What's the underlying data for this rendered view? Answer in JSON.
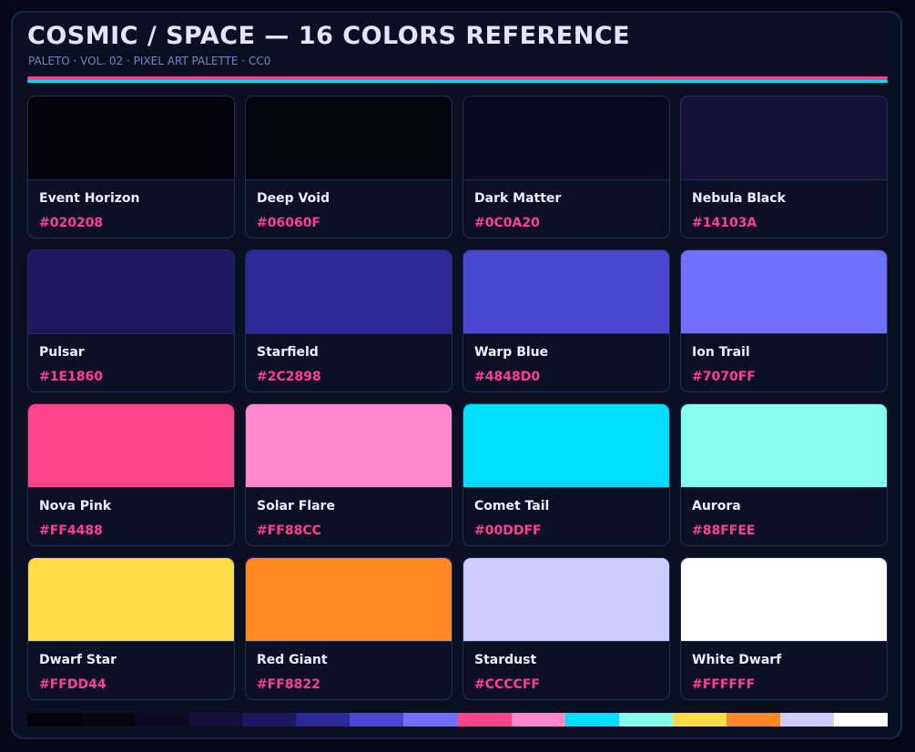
{
  "header": {
    "title": "COSMIC / SPACE — 16 COLORS REFERENCE",
    "subtitle": "PALETO · VOL. 02 · PIXEL ART PALETTE · CC0"
  },
  "accent_colors": {
    "rule_top": "#ff3e8a",
    "rule_bottom": "#00d8ff",
    "hex_text": "#ff3e9a"
  },
  "swatches": [
    {
      "name": "Event Horizon",
      "hex": "#020208"
    },
    {
      "name": "Deep Void",
      "hex": "#06060F"
    },
    {
      "name": "Dark Matter",
      "hex": "#0C0A20"
    },
    {
      "name": "Nebula Black",
      "hex": "#14103A"
    },
    {
      "name": "Pulsar",
      "hex": "#1E1860"
    },
    {
      "name": "Starfield",
      "hex": "#2C2898"
    },
    {
      "name": "Warp Blue",
      "hex": "#4848D0"
    },
    {
      "name": "Ion Trail",
      "hex": "#7070FF"
    },
    {
      "name": "Nova Pink",
      "hex": "#FF4488"
    },
    {
      "name": "Solar Flare",
      "hex": "#FF88CC"
    },
    {
      "name": "Comet Tail",
      "hex": "#00DDFF"
    },
    {
      "name": "Aurora",
      "hex": "#88FFEE"
    },
    {
      "name": "Dwarf Star",
      "hex": "#FFDD44"
    },
    {
      "name": "Red Giant",
      "hex": "#FF8822"
    },
    {
      "name": "Stardust",
      "hex": "#CCCCFF"
    },
    {
      "name": "White Dwarf",
      "hex": "#FFFFFF"
    }
  ]
}
